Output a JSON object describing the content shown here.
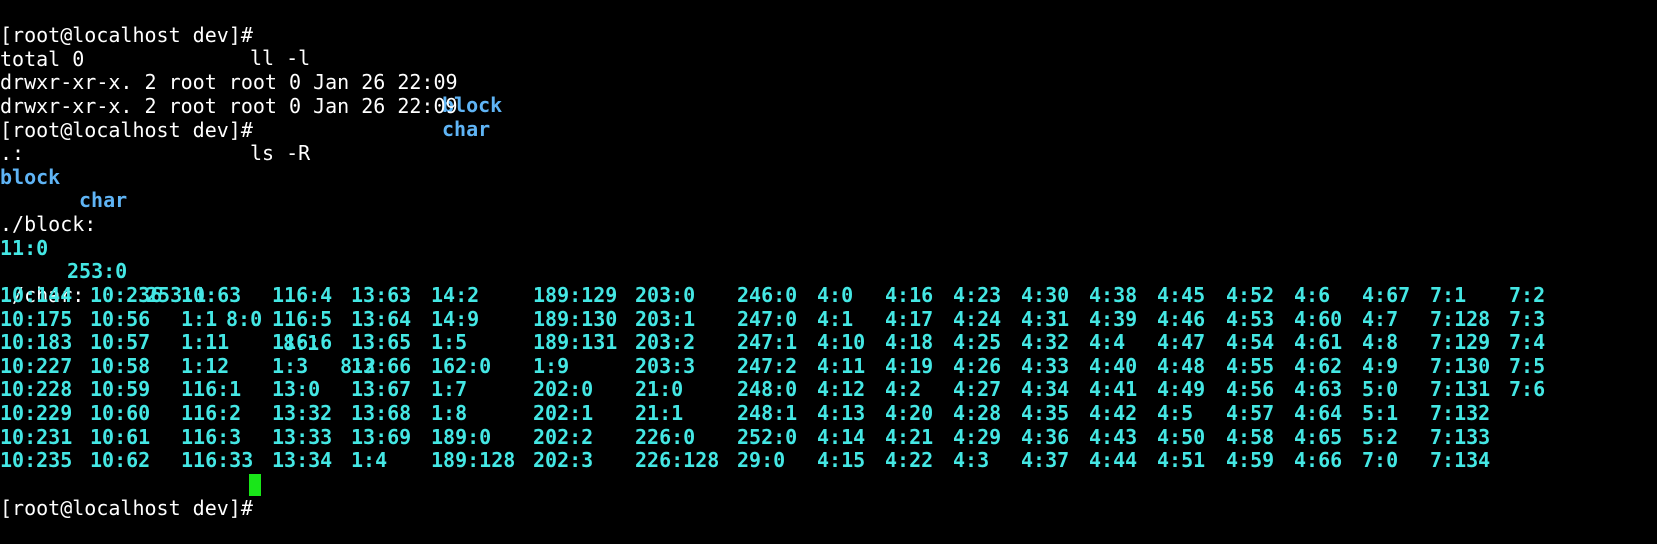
{
  "colors": {
    "background": "#000000",
    "text": "#ffffff",
    "directory": "#5fb4f5",
    "device_file": "#44e7e4",
    "cursor": "#19e619"
  },
  "prompt": "[root@localhost dev]#",
  "commands": {
    "ll": "ll -l",
    "ls": "ls -R"
  },
  "ll_output": {
    "total": "total 0",
    "entries": [
      {
        "meta": "drwxr-xr-x. 2 root root 0 Jan 26 22:09",
        "name": "block"
      },
      {
        "meta": "drwxr-xr-x. 2 root root 0 Jan 26 22:09",
        "name": "char"
      }
    ]
  },
  "ls_output": {
    "root_header": ".:",
    "root_items": [
      "block",
      "char"
    ],
    "block_header": "./block:",
    "block_items": [
      "11:0",
      "253:0",
      "253:1",
      "8:0",
      "8:1",
      "8:2"
    ],
    "char_header": "./char:",
    "char_columns": [
      [
        "10:144",
        "10:175",
        "10:183",
        "10:227",
        "10:228",
        "10:229",
        "10:231",
        "10:235"
      ],
      [
        "10:236",
        "10:56",
        "10:57",
        "10:58",
        "10:59",
        "10:60",
        "10:61",
        "10:62"
      ],
      [
        "10:63",
        "1:1",
        "1:11",
        "1:12",
        "116:1",
        "116:2",
        "116:3",
        "116:33"
      ],
      [
        "116:4",
        "116:5",
        "116:6",
        "1:3",
        "13:0",
        "13:32",
        "13:33",
        "13:34"
      ],
      [
        "13:63",
        "13:64",
        "13:65",
        "13:66",
        "13:67",
        "13:68",
        "13:69",
        "1:4"
      ],
      [
        "14:2",
        "14:9",
        "1:5",
        "162:0",
        "1:7",
        "1:8",
        "189:0",
        "189:128"
      ],
      [
        "189:129",
        "189:130",
        "189:131",
        "1:9",
        "202:0",
        "202:1",
        "202:2",
        "202:3"
      ],
      [
        "203:0",
        "203:1",
        "203:2",
        "203:3",
        "21:0",
        "21:1",
        "226:0",
        "226:128"
      ],
      [
        "246:0",
        "247:0",
        "247:1",
        "247:2",
        "248:0",
        "248:1",
        "252:0",
        "29:0"
      ],
      [
        "4:0",
        "4:1",
        "4:10",
        "4:11",
        "4:12",
        "4:13",
        "4:14",
        "4:15"
      ],
      [
        "4:16",
        "4:17",
        "4:18",
        "4:19",
        "4:2",
        "4:20",
        "4:21",
        "4:22"
      ],
      [
        "4:23",
        "4:24",
        "4:25",
        "4:26",
        "4:27",
        "4:28",
        "4:29",
        "4:3"
      ],
      [
        "4:30",
        "4:31",
        "4:32",
        "4:33",
        "4:34",
        "4:35",
        "4:36",
        "4:37"
      ],
      [
        "4:38",
        "4:39",
        "4:4",
        "4:40",
        "4:41",
        "4:42",
        "4:43",
        "4:44"
      ],
      [
        "4:45",
        "4:46",
        "4:47",
        "4:48",
        "4:49",
        "4:5",
        "4:50",
        "4:51"
      ],
      [
        "4:52",
        "4:53",
        "4:54",
        "4:55",
        "4:56",
        "4:57",
        "4:58",
        "4:59"
      ],
      [
        "4:6",
        "4:60",
        "4:61",
        "4:62",
        "4:63",
        "4:64",
        "4:65",
        "4:66"
      ],
      [
        "4:67",
        "4:7",
        "4:8",
        "4:9",
        "5:0",
        "5:1",
        "5:2",
        "7:0"
      ],
      [
        "7:1",
        "7:128",
        "7:129",
        "7:130",
        "7:131",
        "7:132",
        "7:133",
        "7:134"
      ],
      [
        "7:2",
        "7:3",
        "7:4",
        "7:5",
        "7:6"
      ]
    ]
  }
}
